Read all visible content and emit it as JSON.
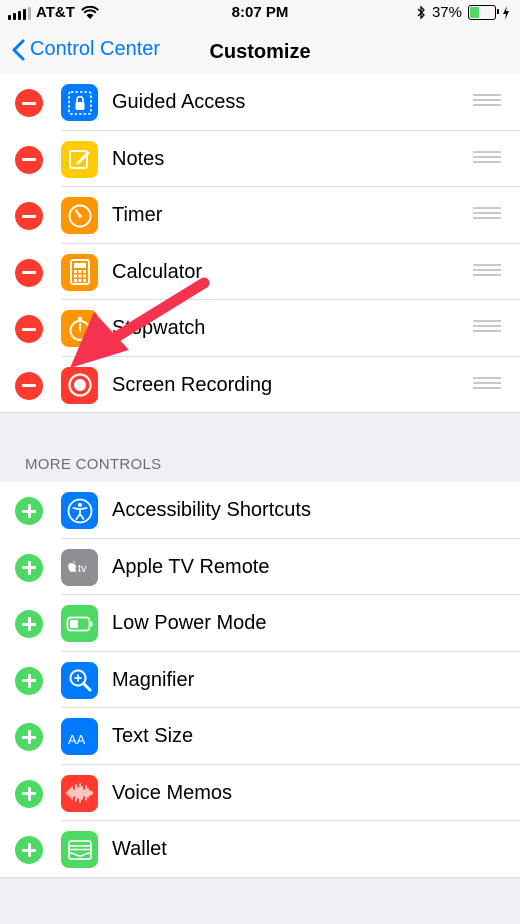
{
  "status_bar": {
    "carrier": "AT&T",
    "time": "8:07 PM",
    "battery_percent": "37%",
    "battery_level": 0.37,
    "icons": [
      "signal-icon",
      "wifi-icon",
      "bluetooth-icon",
      "battery-icon",
      "charging-icon"
    ]
  },
  "nav": {
    "back_label": "Control Center",
    "title": "Customize"
  },
  "included_controls": [
    {
      "label": "Guided Access",
      "icon": "guided-access-icon",
      "color": "#007aff"
    },
    {
      "label": "Notes",
      "icon": "notes-icon",
      "color": "#ffcc00"
    },
    {
      "label": "Timer",
      "icon": "timer-icon",
      "color": "#ff9500"
    },
    {
      "label": "Calculator",
      "icon": "calculator-icon",
      "color": "#ff9500"
    },
    {
      "label": "Stopwatch",
      "icon": "stopwatch-icon",
      "color": "#ff9500"
    },
    {
      "label": "Screen Recording",
      "icon": "screen-recording-icon",
      "color": "#ff3b30"
    }
  ],
  "more_controls": {
    "header": "MORE CONTROLS",
    "items": [
      {
        "label": "Accessibility Shortcuts",
        "icon": "accessibility-icon",
        "color": "#007aff"
      },
      {
        "label": "Apple TV Remote",
        "icon": "apple-tv-icon",
        "color": "#8e8e93",
        "icon_text": "tv"
      },
      {
        "label": "Low Power Mode",
        "icon": "battery-low-power-icon",
        "color": "#4cd964"
      },
      {
        "label": "Magnifier",
        "icon": "magnifier-icon",
        "color": "#007aff"
      },
      {
        "label": "Text Size",
        "icon": "text-size-icon",
        "color": "#007aff",
        "icon_text": "AA"
      },
      {
        "label": "Voice Memos",
        "icon": "voice-memos-icon",
        "color": "#ff3b30"
      },
      {
        "label": "Wallet",
        "icon": "wallet-icon",
        "color": "#4cd964"
      }
    ]
  },
  "annotation": {
    "color": "#f5334f",
    "icon": "red-arrow-annotation"
  }
}
